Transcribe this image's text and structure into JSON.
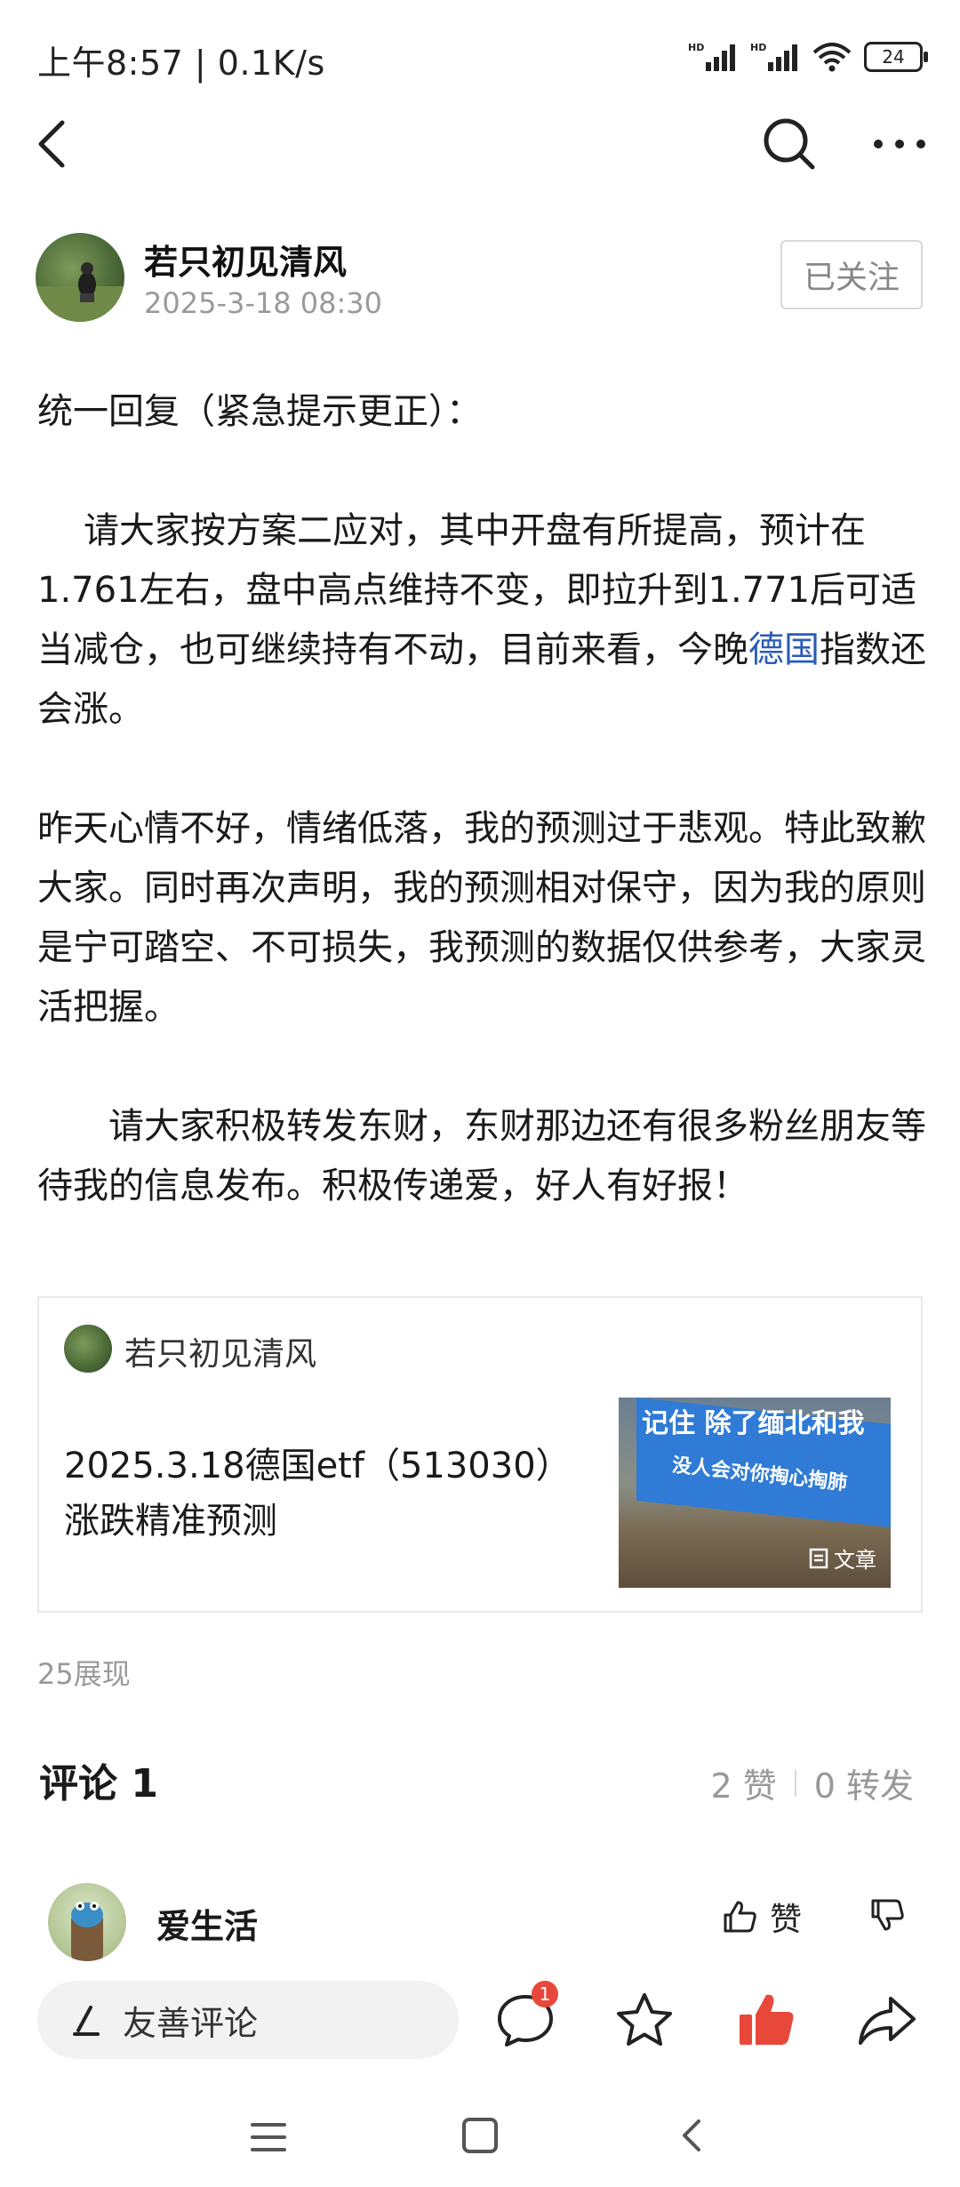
{
  "status": {
    "time": "上午8:57 | 0.1K/s",
    "battery": "24",
    "signal1": "HD",
    "signal2": "HD"
  },
  "post": {
    "author": "若只初见清风",
    "time": "2025-3-18 08:30",
    "follow_label": "已关注",
    "heading": "统一回复（紧急提示更正）：",
    "p1_part1": "请大家按方案二应对，其中开盘有所提高，预计在1.761左右，盘中高点维持不变，即拉升到1.771后可适当减仓，也可继续持有不动，目前来看，今晚",
    "p1_link": "德国",
    "p1_part2": "指数还会涨。",
    "p2": "昨天心情不好，情绪低落，我的预测过于悲观。特此致歉大家。同时再次声明，我的预测相对保守，因为我的原则是宁可踏空、不可损失，我预测的数据仅供参考，大家灵活把握。",
    "p3": "请大家积极转发东财，东财那边还有很多粉丝朋友等待我的信息发布。积极传递爱，好人有好报！",
    "impressions": "25展现"
  },
  "card": {
    "author": "若只初见清风",
    "title": "2025.3.18德国etf（513030）涨跌精准预测",
    "thumb_line1": "记住 除了缅北和我",
    "thumb_line2": "没人会对你掏心掏肺",
    "thumb_badge": "文章"
  },
  "comments": {
    "title": "评论 1",
    "likes": "2 赞",
    "shares": "0 转发",
    "items": [
      {
        "name": "爱生活",
        "like_label": "赞"
      }
    ]
  },
  "bottom_bar": {
    "input_placeholder": "友善评论",
    "comment_badge": "1"
  },
  "colors": {
    "link": "#2a5bb8",
    "accent_red": "#e8483a"
  }
}
